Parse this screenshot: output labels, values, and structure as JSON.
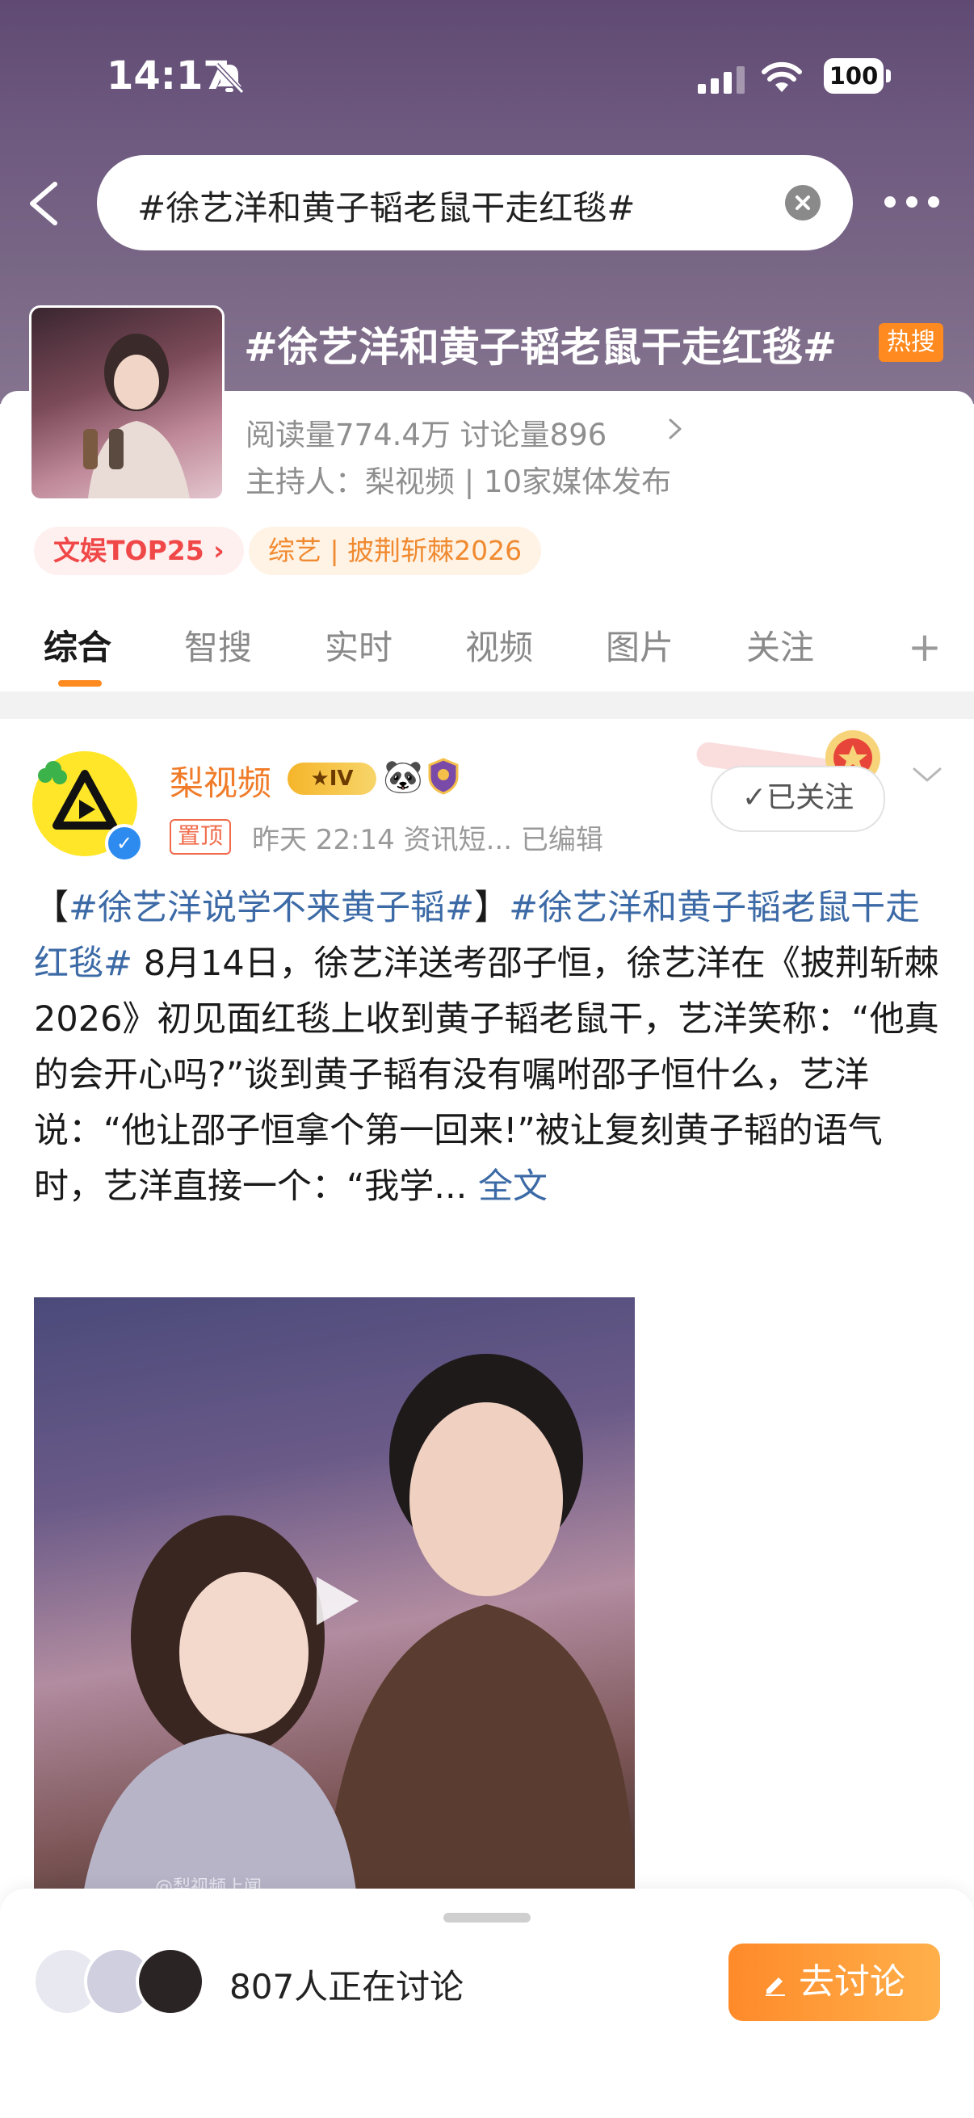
{
  "status_bar": {
    "time": "14:17",
    "battery": "100"
  },
  "search": {
    "query": "#徐艺洋和黄子韬老鼠干走红毯#"
  },
  "topic": {
    "title": "#徐艺洋和黄子韬老鼠干走红毯#",
    "hot_badge": "热搜",
    "stats": "阅读量774.4万  讨论量896",
    "host": "主持人：梨视频 | 10家媒体发布",
    "tag_rank": "文娱TOP25 ›",
    "tag_category": "综艺 | 披荆斩棘2026"
  },
  "tabs": [
    "综合",
    "智搜",
    "实时",
    "视频",
    "图片",
    "关注"
  ],
  "post": {
    "author": "梨视频",
    "level": "IV",
    "pin": "置顶",
    "meta": "昨天 22:14  资讯短...  已编辑",
    "follow": "✓已关注",
    "text_open": "【",
    "tag1": "#徐艺洋说学不来黄子韬#",
    "text_close": "】",
    "tag2": "#徐艺洋和黄子韬老鼠干走红毯#",
    "body": " 8月14日，徐艺洋送考邵子恒，徐艺洋在《披荆斩棘2026》初见面红毯上收到黄子韬老鼠干，艺洋笑称：“他真的会开心吗?”谈到黄子韬有没有嘱咐邵子恒什么，艺洋说：“他让邵子恒拿个第一回来!”被让复刻黄子韬的语气时，艺洋直接一个：“我学... ",
    "full_text": "全文",
    "watermark": "@梨视频上闻"
  },
  "bottom": {
    "discussing": "807人正在讨论",
    "go_button": "去讨论"
  },
  "colors": {
    "accent": "#ff8a1f",
    "link": "#3c6aa6",
    "author": "#f07b28"
  }
}
